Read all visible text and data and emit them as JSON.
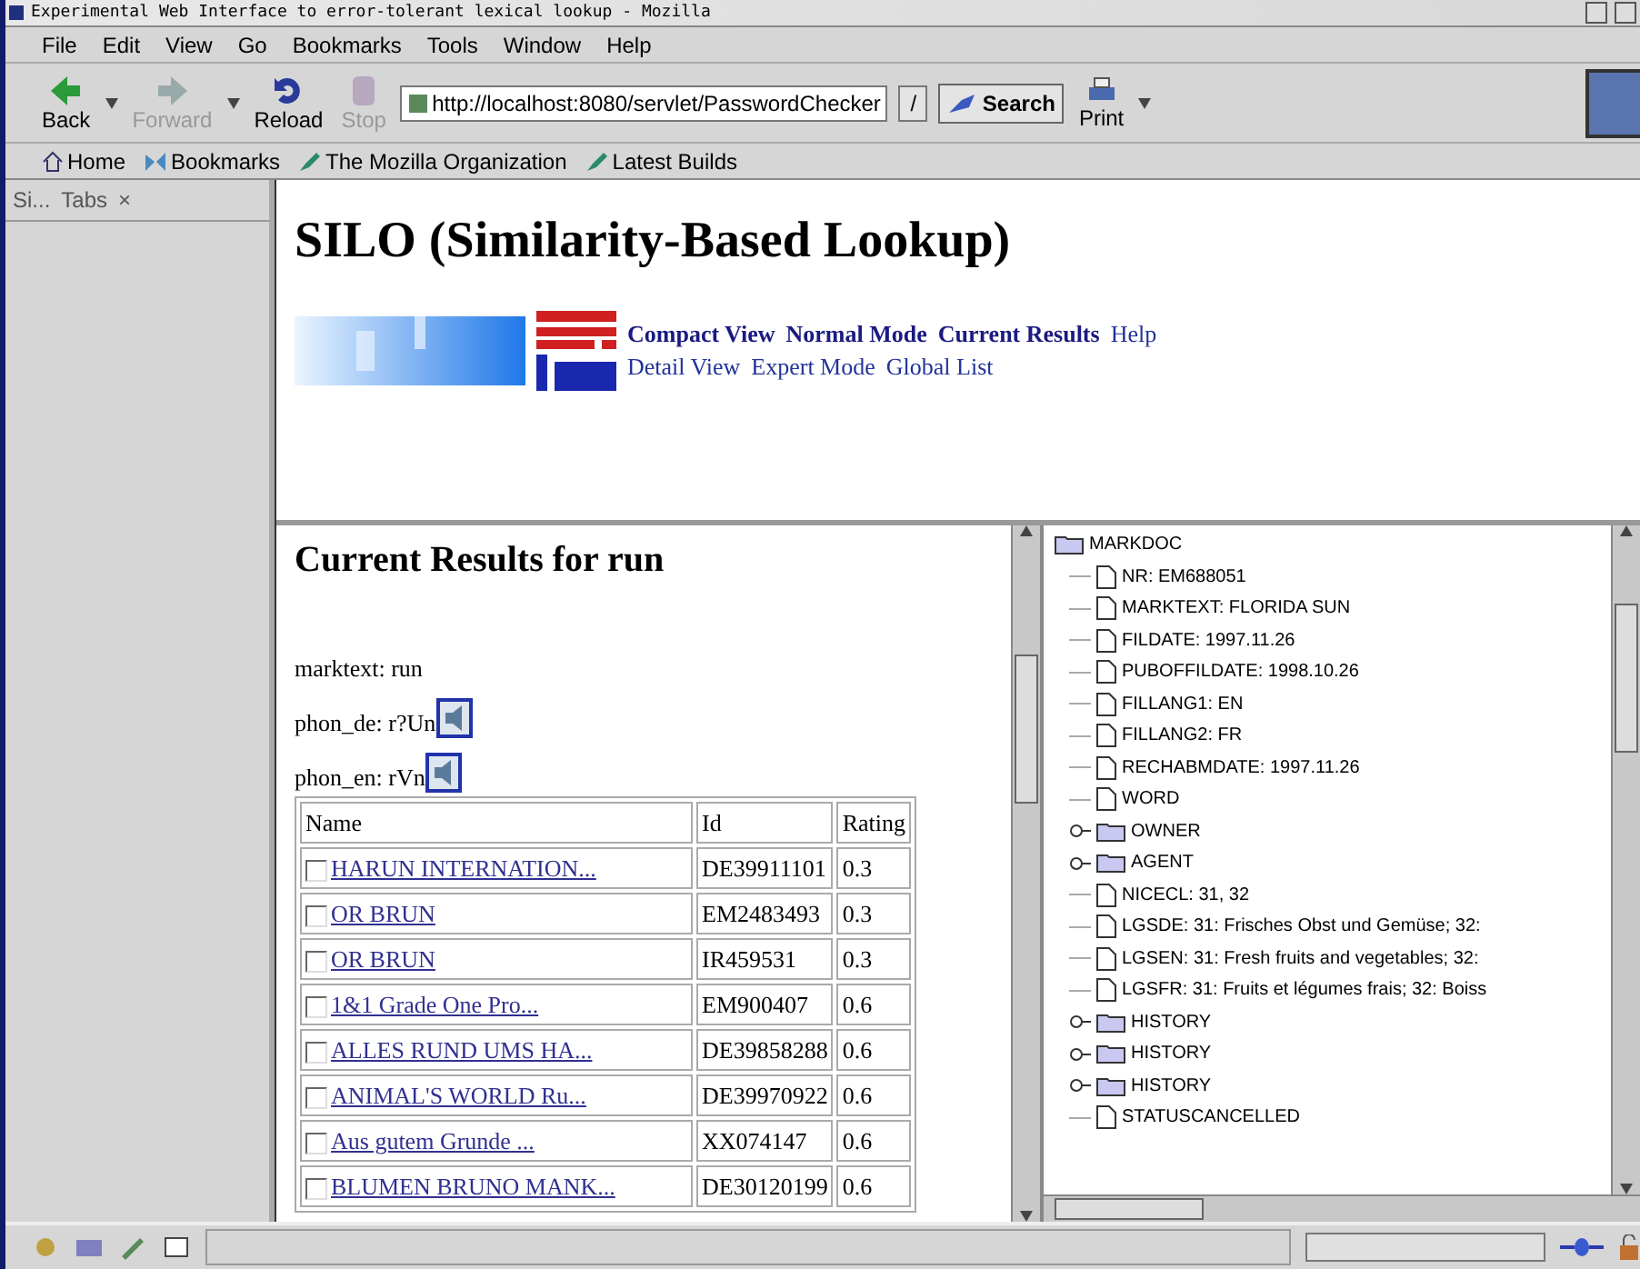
{
  "window": {
    "title": "Experimental Web Interface to error-tolerant lexical lookup - Mozilla"
  },
  "menu": [
    "File",
    "Edit",
    "View",
    "Go",
    "Bookmarks",
    "Tools",
    "Window",
    "Help"
  ],
  "toolbar": {
    "buttons": [
      {
        "kind": "back",
        "label": "Back",
        "disabled": false
      },
      {
        "kind": "forward",
        "label": "Forward",
        "disabled": true
      },
      {
        "kind": "reload",
        "label": "Reload",
        "disabled": false
      },
      {
        "kind": "stop",
        "label": "Stop",
        "disabled": true
      }
    ],
    "url": "http://localhost:8080/servlet/PasswordChecker",
    "go_label": "/",
    "search_label": "Search",
    "print_label": "Print"
  },
  "personal_bar": [
    {
      "kind": "home",
      "label": "Home"
    },
    {
      "kind": "bookmarks",
      "label": "Bookmarks"
    },
    {
      "kind": "link",
      "label": "The Mozilla Organization"
    },
    {
      "kind": "link",
      "label": "Latest Builds"
    }
  ],
  "sidebar": {
    "title": "Si...",
    "tabs_label": "Tabs",
    "close": "×"
  },
  "header": {
    "title": "SILO (Similarity-Based Lookup)",
    "nav_rows": [
      [
        {
          "label": "Compact View",
          "selected": true
        },
        {
          "label": "Normal Mode",
          "selected": true
        },
        {
          "label": "Current Results",
          "selected": true
        },
        {
          "label": "Help",
          "selected": false
        }
      ],
      [
        {
          "label": "Detail View",
          "selected": false
        },
        {
          "label": "Expert Mode",
          "selected": false
        },
        {
          "label": "Global List",
          "selected": false
        }
      ]
    ]
  },
  "results": {
    "title": "Current Results for run",
    "marktext": "marktext: run",
    "phon": [
      "phon_de: r?Un",
      "phon_en: rVn"
    ],
    "table": {
      "columns": [
        "Name",
        "Id",
        "Rating"
      ],
      "rows": [
        {
          "name": "HARUN INTERNATION...",
          "id": "DE39911101",
          "rating": "0.3",
          "checked": false
        },
        {
          "name": "OR BRUN",
          "id": "EM2483493",
          "rating": "0.3",
          "checked": false
        },
        {
          "name": "OR BRUN",
          "id": "IR459531",
          "rating": "0.3",
          "checked": false
        },
        {
          "name": "1&1 Grade One Pro...",
          "id": "EM900407",
          "rating": "0.6",
          "checked": false
        },
        {
          "name": "ALLES RUND UMS HA...",
          "id": "DE39858288",
          "rating": "0.6",
          "checked": false
        },
        {
          "name": "ANIMAL'S WORLD Ru...",
          "id": "DE39970922",
          "rating": "0.6",
          "checked": false
        },
        {
          "name": "Aus gutem Grunde ...",
          "id": "XX074147",
          "rating": "0.6",
          "checked": false
        },
        {
          "name": "BLUMEN BRUNO MANK...",
          "id": "DE30120199",
          "rating": "0.6",
          "checked": false
        }
      ]
    }
  },
  "tree": {
    "label": "MARKDOC",
    "kind": "folder",
    "children": [
      {
        "label": "NR: EM688051",
        "kind": "leaf"
      },
      {
        "label": "MARKTEXT: FLORIDA SUN",
        "kind": "leaf"
      },
      {
        "label": "FILDATE: 1997.11.26",
        "kind": "leaf"
      },
      {
        "label": "PUBOFFILDATE: 1998.10.26",
        "kind": "leaf"
      },
      {
        "label": "FILLANG1: EN",
        "kind": "leaf"
      },
      {
        "label": "FILLANG2: FR",
        "kind": "leaf"
      },
      {
        "label": "RECHABMDATE: 1997.11.26",
        "kind": "leaf"
      },
      {
        "label": "WORD",
        "kind": "leaf"
      },
      {
        "label": "OWNER",
        "kind": "folder",
        "expanded": false
      },
      {
        "label": "AGENT",
        "kind": "folder",
        "expanded": false
      },
      {
        "label": "NICECL: 31, 32",
        "kind": "leaf"
      },
      {
        "label": "LGSDE: 31: Frisches Obst und Gemüse; 32:",
        "kind": "leaf"
      },
      {
        "label": "LGSEN: 31: Fresh fruits and vegetables; 32:",
        "kind": "leaf"
      },
      {
        "label": "LGSFR: 31: Fruits et légumes frais; 32: Boiss",
        "kind": "leaf"
      },
      {
        "label": "HISTORY",
        "kind": "folder",
        "expanded": false
      },
      {
        "label": "HISTORY",
        "kind": "folder",
        "expanded": false
      },
      {
        "label": "HISTORY",
        "kind": "folder",
        "expanded": false
      },
      {
        "label": "STATUSCANCELLED",
        "kind": "leaf"
      }
    ]
  }
}
